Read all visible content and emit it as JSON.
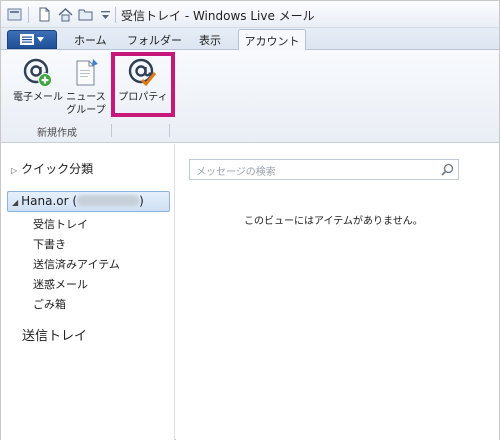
{
  "window": {
    "title": "受信トレイ - Windows Live メール"
  },
  "quick_access": [
    "new-document-icon",
    "home-icon",
    "folder-icon",
    "dropdown-icon"
  ],
  "tabs": {
    "home": "ホーム",
    "folder": "フォルダー",
    "view": "表示",
    "account": "アカウント"
  },
  "ribbon": {
    "email_label": "電子メール",
    "newsgroup_label_line1": "ニュース",
    "newsgroup_label_line2": "グループ",
    "properties_label": "プロパティ",
    "group_new": "新規作成"
  },
  "sidebar": {
    "quick_views": "クイック分類",
    "account_prefix": "Hana.or (",
    "account_suffix": ")",
    "folders": [
      "受信トレイ",
      "下書き",
      "送信済みアイテム",
      "迷惑メール",
      "ごみ箱"
    ],
    "outbox": "送信トレイ"
  },
  "main": {
    "search_placeholder": "メッセージの検索",
    "empty_message": "このビューにはアイテムがありません。"
  },
  "colors": {
    "accent": "#1e4f98",
    "highlight": "#c5187a",
    "selection": "#cfe0f5"
  }
}
